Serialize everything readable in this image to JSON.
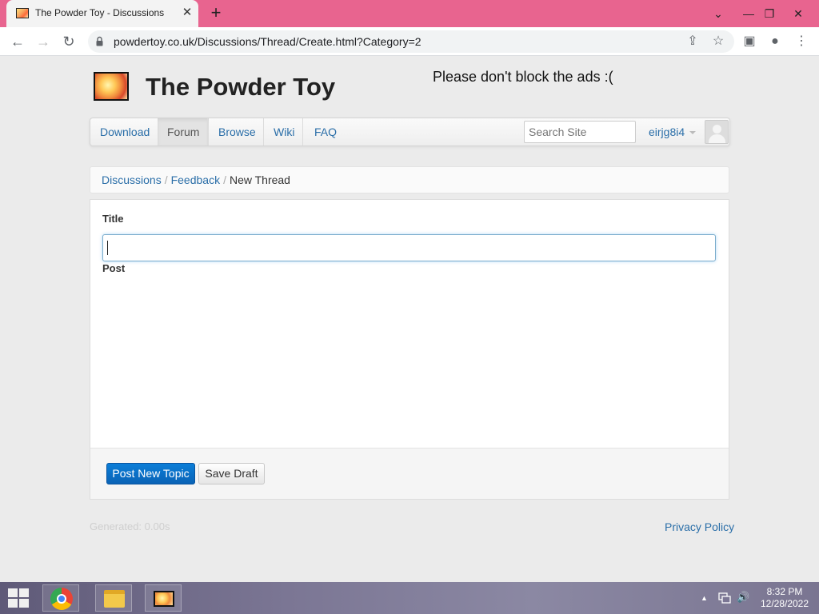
{
  "browser": {
    "tab_title": "The Powder Toy - Discussions",
    "tab_close": "✕",
    "new_tab": "+",
    "url": "powdertoy.co.uk/Discussions/Thread/Create.html?Category=2",
    "window_controls": [
      "⌄",
      "—",
      "❐",
      "✕"
    ]
  },
  "site": {
    "title": "The Powder Toy",
    "ads_note": "Please don't block the ads :("
  },
  "nav": {
    "items": [
      "Download",
      "Forum",
      "Browse",
      "Wiki",
      "FAQ"
    ],
    "active": "Forum",
    "search_placeholder": "Search Site",
    "username": "eirjg8i4"
  },
  "breadcrumb": {
    "items": [
      "Discussions",
      "Feedback"
    ],
    "current": "New Thread",
    "separator": "/"
  },
  "form": {
    "title_label": "Title",
    "title_value": "",
    "post_label": "Post",
    "submit_label": "Post New Topic",
    "draft_label": "Save Draft"
  },
  "footer": {
    "generated": "Generated: 0.00s",
    "privacy": "Privacy Policy"
  },
  "taskbar": {
    "time": "8:32 PM",
    "date": "12/28/2022",
    "tray_chevron": "▲",
    "volume": "🔊"
  },
  "colors": {
    "tab_bar": "#e8648f",
    "link": "#2a6ea8",
    "primary_button": "#0a6fc7"
  }
}
